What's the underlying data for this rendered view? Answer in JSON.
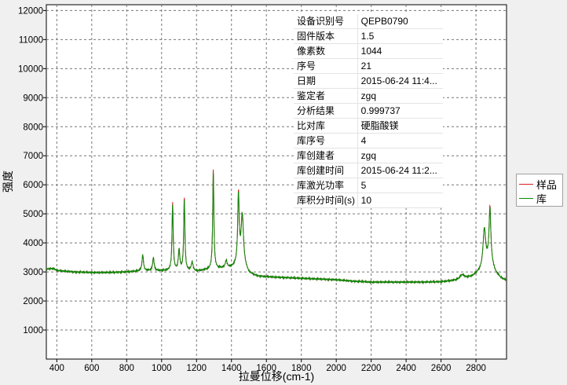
{
  "chart_data": {
    "type": "line",
    "xlabel": "拉曼位移(cm-1)",
    "ylabel": "强度",
    "xlim": [
      340,
      2975
    ],
    "ylim": [
      0,
      12200
    ],
    "xticks": [
      400,
      600,
      800,
      1000,
      1200,
      1400,
      1600,
      1800,
      2000,
      2200,
      2400,
      2600,
      2800
    ],
    "yticks": [
      1000,
      2000,
      3000,
      4000,
      5000,
      6000,
      7000,
      8000,
      9000,
      10000,
      11000,
      12000
    ],
    "grid": true,
    "legend_position": "right",
    "baseline": [
      [
        340,
        3100
      ],
      [
        380,
        3120
      ],
      [
        400,
        3050
      ],
      [
        500,
        3000
      ],
      [
        600,
        2980
      ],
      [
        700,
        2980
      ],
      [
        800,
        3000
      ],
      [
        900,
        3040
      ],
      [
        1000,
        3040
      ],
      [
        1100,
        3050
      ],
      [
        1200,
        3020
      ],
      [
        1300,
        3100
      ],
      [
        1400,
        3150
      ],
      [
        1460,
        3300
      ],
      [
        1500,
        2950
      ],
      [
        1550,
        2850
      ],
      [
        1600,
        2830
      ],
      [
        1800,
        2780
      ],
      [
        2000,
        2730
      ],
      [
        2100,
        2680
      ],
      [
        2200,
        2650
      ],
      [
        2400,
        2650
      ],
      [
        2500,
        2650
      ],
      [
        2600,
        2660
      ],
      [
        2700,
        2720
      ],
      [
        2780,
        2850
      ],
      [
        2830,
        3050
      ],
      [
        2880,
        3400
      ],
      [
        2910,
        3000
      ],
      [
        2940,
        2800
      ],
      [
        2975,
        2700
      ]
    ],
    "peaks": [
      {
        "x": 892,
        "height": 550,
        "width": 5
      },
      {
        "x": 953,
        "height": 450,
        "width": 5
      },
      {
        "x": 1063,
        "height": 2250,
        "width": 4
      },
      {
        "x": 1100,
        "height": 700,
        "width": 5
      },
      {
        "x": 1130,
        "height": 2450,
        "width": 4
      },
      {
        "x": 1175,
        "height": 300,
        "width": 6
      },
      {
        "x": 1296,
        "height": 3350,
        "width": 4
      },
      {
        "x": 1370,
        "height": 250,
        "width": 6
      },
      {
        "x": 1440,
        "height": 2350,
        "width": 5
      },
      {
        "x": 1462,
        "height": 1650,
        "width": 8
      },
      {
        "x": 2720,
        "height": 150,
        "width": 15
      },
      {
        "x": 2848,
        "height": 1300,
        "width": 9
      },
      {
        "x": 2880,
        "height": 1750,
        "width": 6
      }
    ],
    "sample_extra": [
      {
        "x": 1063,
        "height": 90
      },
      {
        "x": 1130,
        "height": 80
      },
      {
        "x": 1296,
        "height": 110
      },
      {
        "x": 1440,
        "height": 80
      },
      {
        "x": 2880,
        "height": 60
      }
    ],
    "series": [
      {
        "name": "样品",
        "color": "#d42020"
      },
      {
        "name": "库",
        "color": "#0a8a0a"
      }
    ]
  },
  "info": [
    {
      "label": "设备识别号",
      "value": "QEPB0790"
    },
    {
      "label": "固件版本",
      "value": "1.5"
    },
    {
      "label": "像素数",
      "value": "1044"
    },
    {
      "label": "序号",
      "value": "21"
    },
    {
      "label": "日期",
      "value": "2015-06-24 11:4..."
    },
    {
      "label": "鉴定者",
      "value": "zgq"
    },
    {
      "label": "分析结果",
      "value": "0.999737"
    },
    {
      "label": "比对库",
      "value": "硬脂酸镁"
    },
    {
      "label": "库序号",
      "value": "4"
    },
    {
      "label": "库创建者",
      "value": "zgq"
    },
    {
      "label": "库创建时间",
      "value": "2015-06-24 11:2..."
    },
    {
      "label": "库激光功率",
      "value": "5"
    },
    {
      "label": "库积分时间(s)",
      "value": "10"
    }
  ]
}
